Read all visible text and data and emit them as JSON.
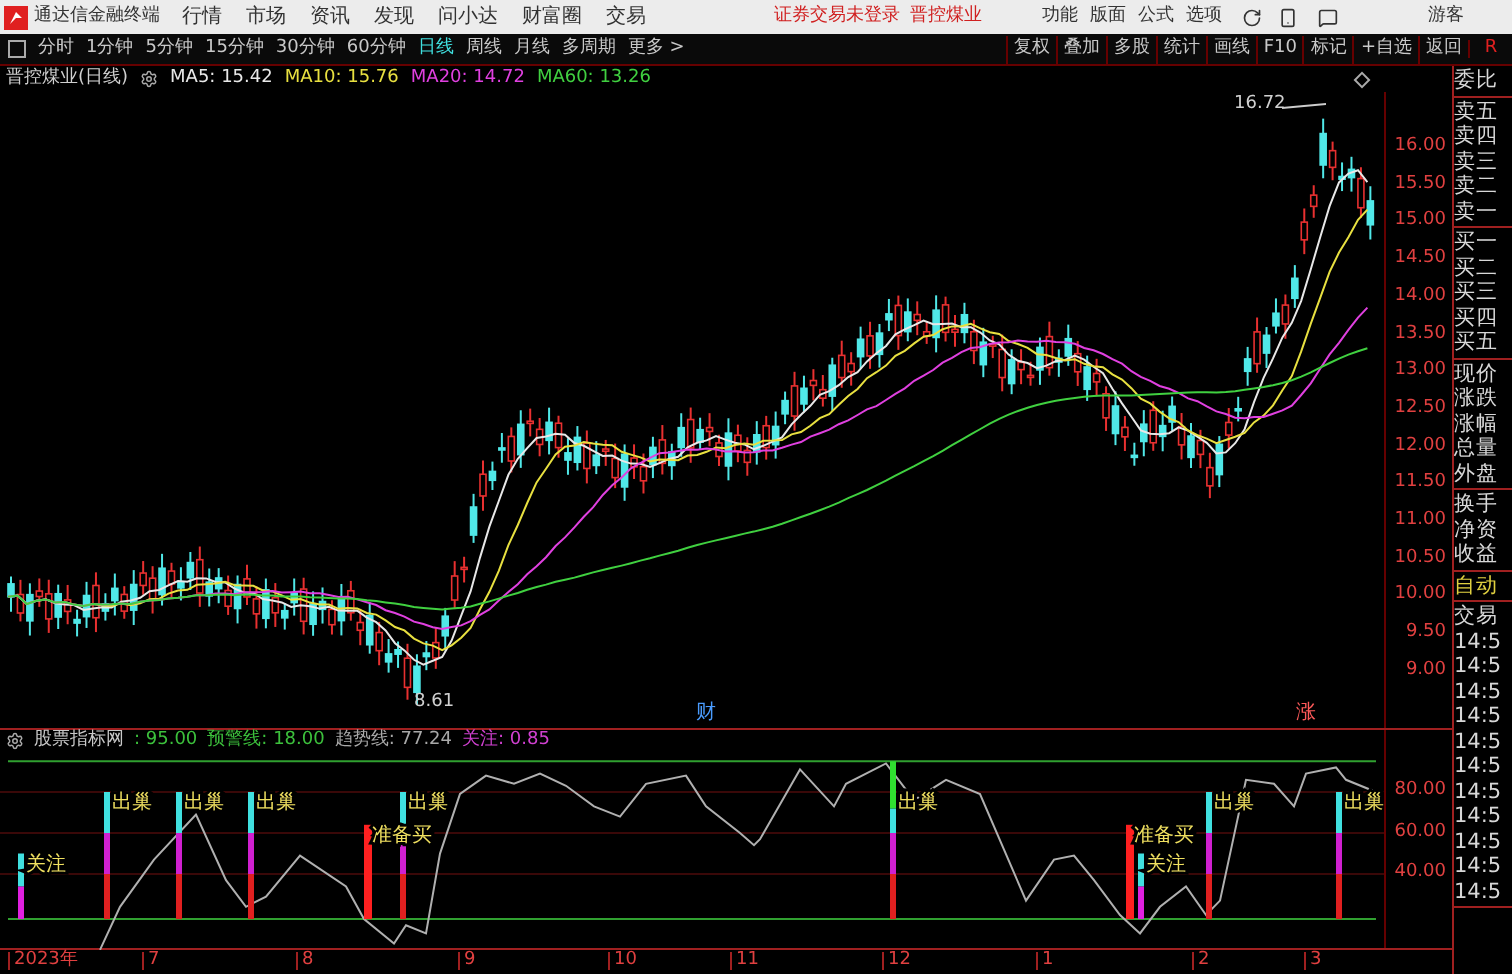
{
  "app": {
    "title": "通达信金融终端",
    "menu": [
      "行情",
      "市场",
      "资讯",
      "发现",
      "问小达",
      "财富圈",
      "交易"
    ],
    "notice": "证券交易未登录",
    "stock_link": "晋控煤业",
    "right_menu": [
      "功能",
      "版面",
      "公式",
      "选项"
    ],
    "user": "游客"
  },
  "toolbar": {
    "periods": [
      {
        "label": "分时",
        "selected": false
      },
      {
        "label": "1分钟",
        "selected": false
      },
      {
        "label": "5分钟",
        "selected": false
      },
      {
        "label": "15分钟",
        "selected": false
      },
      {
        "label": "30分钟",
        "selected": false
      },
      {
        "label": "60分钟",
        "selected": false
      },
      {
        "label": "日线",
        "selected": true
      },
      {
        "label": "周线",
        "selected": false
      },
      {
        "label": "月线",
        "selected": false
      },
      {
        "label": "多周期",
        "selected": false
      },
      {
        "label": "更多 >",
        "selected": false
      }
    ],
    "actions": [
      "复权",
      "叠加",
      "多股",
      "统计",
      "画线",
      "F10",
      "标记",
      "+自选",
      "返回"
    ],
    "corner": "R"
  },
  "chart": {
    "title": "晋控煤业(日线)",
    "ma": [
      {
        "label": "MA5: 15.42",
        "color": "#e8e8e8"
      },
      {
        "label": "MA10: 15.76",
        "color": "#e8e040"
      },
      {
        "label": "MA20: 14.72",
        "color": "#e040e0"
      },
      {
        "label": "MA60: 13.26",
        "color": "#40d040"
      }
    ],
    "price_axis": [
      "16.00",
      "15.50",
      "15.00",
      "14.50",
      "14.00",
      "13.50",
      "13.00",
      "12.50",
      "12.00",
      "11.50",
      "11.00",
      "10.50",
      "10.00",
      "9.50",
      "9.00"
    ],
    "high_label": "16.72",
    "low_label": "8.61",
    "markers": [
      {
        "text": "财",
        "color": "#4a9cff"
      },
      {
        "text": "涨",
        "color": "#ff5a5a"
      }
    ]
  },
  "indicator": {
    "legend": [
      {
        "text": "股票指标网",
        "color": "#c8c8c8"
      },
      {
        "text": ": 95.00",
        "color": "#3cc03c"
      },
      {
        "text": "预警线: 18.00",
        "color": "#3cc03c"
      },
      {
        "text": "趋势线: 77.24",
        "color": "#a8a8a8"
      },
      {
        "text": "关注: 0.85",
        "color": "#d040d0"
      }
    ],
    "signals": [
      {
        "kind": "watch",
        "label": "关注"
      },
      {
        "kind": "exit",
        "label": "出巢"
      },
      {
        "kind": "exit",
        "label": "出巢"
      },
      {
        "kind": "exit",
        "label": "出巢"
      },
      {
        "kind": "buy",
        "label": "准备买"
      },
      {
        "kind": "exit",
        "label": "出巢"
      },
      {
        "kind": "exit_peak",
        "label": "出巢"
      },
      {
        "kind": "buy",
        "label": "准备买"
      },
      {
        "kind": "watch",
        "label": "关注"
      },
      {
        "kind": "exit",
        "label": "出巢"
      },
      {
        "kind": "exit",
        "label": "出巢"
      }
    ],
    "axis": [
      "80.00",
      "60.00",
      "40.00"
    ]
  },
  "date_axis": [
    "2023年",
    "7",
    "8",
    "9",
    "10",
    "11",
    "12",
    "1",
    "2",
    "3"
  ],
  "quote_panel": [
    {
      "kind": "label",
      "items": [
        "委比"
      ]
    },
    {
      "kind": "label",
      "items": [
        "卖五",
        "卖四",
        "卖三",
        "卖二",
        "卖一"
      ]
    },
    {
      "kind": "label",
      "items": [
        "买一",
        "买二",
        "买三",
        "买四",
        "买五"
      ]
    },
    {
      "kind": "label",
      "items": [
        "现价",
        "涨跌",
        "涨幅",
        "总量",
        "外盘"
      ]
    },
    {
      "kind": "label",
      "items": [
        "换手",
        "净资",
        "收益"
      ]
    },
    {
      "kind": "mode",
      "items": [
        "自动"
      ]
    },
    {
      "kind": "label",
      "items": [
        "交易",
        "14:5",
        "14:5",
        "14:5",
        "14:5",
        "14:5",
        "14:5",
        "14:5",
        "14:5",
        "14:5",
        "14:5",
        "14:5"
      ]
    }
  ]
}
